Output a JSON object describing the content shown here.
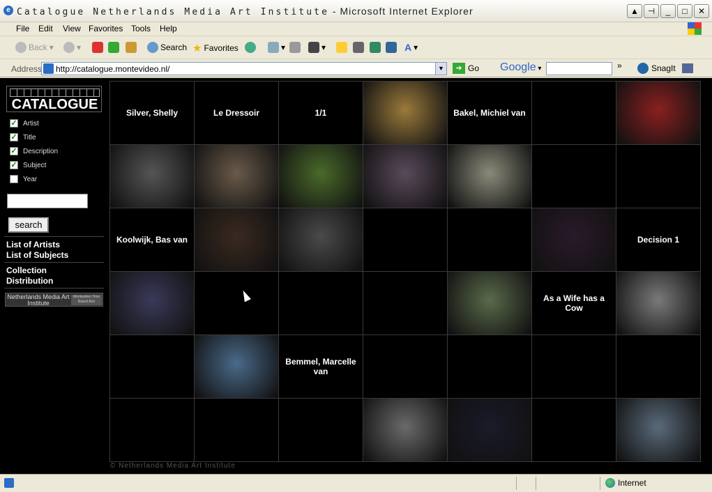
{
  "window": {
    "title_site": "Catalogue Netherlands Media Art Institute",
    "title_app": " - Microsoft Internet Explorer"
  },
  "menu": [
    "File",
    "Edit",
    "View",
    "Favorites",
    "Tools",
    "Help"
  ],
  "toolbar": {
    "back_label": "Back",
    "search_label": "Search",
    "favorites_label": "Favorites"
  },
  "address": {
    "label": "Address",
    "url": "http://catalogue.montevideo.nl/",
    "go_label": "Go",
    "google_label": "Google",
    "snagit_label": "SnagIt"
  },
  "sidebar": {
    "logo_text": "CATALOGUE",
    "filters": [
      {
        "label": "Artist",
        "checked": true
      },
      {
        "label": "Title",
        "checked": true
      },
      {
        "label": "Description",
        "checked": true
      },
      {
        "label": "Subject",
        "checked": true
      },
      {
        "label": "Year",
        "checked": false
      }
    ],
    "search_value": "",
    "search_button": "search",
    "links": [
      "List of Artists",
      "List of Subjects",
      "Collection",
      "Distribution"
    ],
    "footer_logo_left": "Netherlands Media Art Institute",
    "footer_logo_right": "Montevideo Time Based Arts"
  },
  "grid": [
    [
      {
        "text": "Silver, Shelly"
      },
      {
        "text": "Le Dressoir"
      },
      {
        "text": "1/1"
      },
      {
        "img": "#9b7a3c"
      },
      {
        "text": "Bakel, Michiel van"
      },
      {
        "text": ""
      },
      {
        "img": "#8a2020"
      }
    ],
    [
      {
        "img": "#555555"
      },
      {
        "img": "#6a5a4a"
      },
      {
        "img": "#4a6a2a"
      },
      {
        "img": "#5a4a5a"
      },
      {
        "img": "#8a8a7a"
      },
      {
        "text": ""
      },
      {
        "text": ""
      }
    ],
    [
      {
        "text": "Koolwijk, Bas van"
      },
      {
        "img": "#3a2a20"
      },
      {
        "img": "#4a4a4a"
      },
      {
        "text": ""
      },
      {
        "text": ""
      },
      {
        "img": "#2a1a2a"
      },
      {
        "text": "Decision 1"
      }
    ],
    [
      {
        "img": "#3a3a5a"
      },
      {
        "text": ""
      },
      {
        "text": ""
      },
      {
        "text": ""
      },
      {
        "img": "#5a6a4a"
      },
      {
        "text": "As a Wife has a Cow"
      },
      {
        "img": "#7a7a7a"
      }
    ],
    [
      {
        "text": ""
      },
      {
        "img": "#4a6a8a"
      },
      {
        "text": "Bemmel, Marcelle van"
      },
      {
        "text": ""
      },
      {
        "text": ""
      },
      {
        "text": ""
      },
      {
        "text": ""
      }
    ],
    [
      {
        "text": ""
      },
      {
        "text": ""
      },
      {
        "text": ""
      },
      {
        "img": "#6a6a6a"
      },
      {
        "img": "#1a1a2a"
      },
      {
        "text": ""
      },
      {
        "img": "#5a6a7a"
      }
    ]
  ],
  "copyright": "© Netherlands Media Art Institute",
  "status": {
    "zone": "Internet"
  },
  "colors": {
    "page_bg": "#000000",
    "grid_line": "#3a3a3a",
    "text": "#ffffff"
  }
}
